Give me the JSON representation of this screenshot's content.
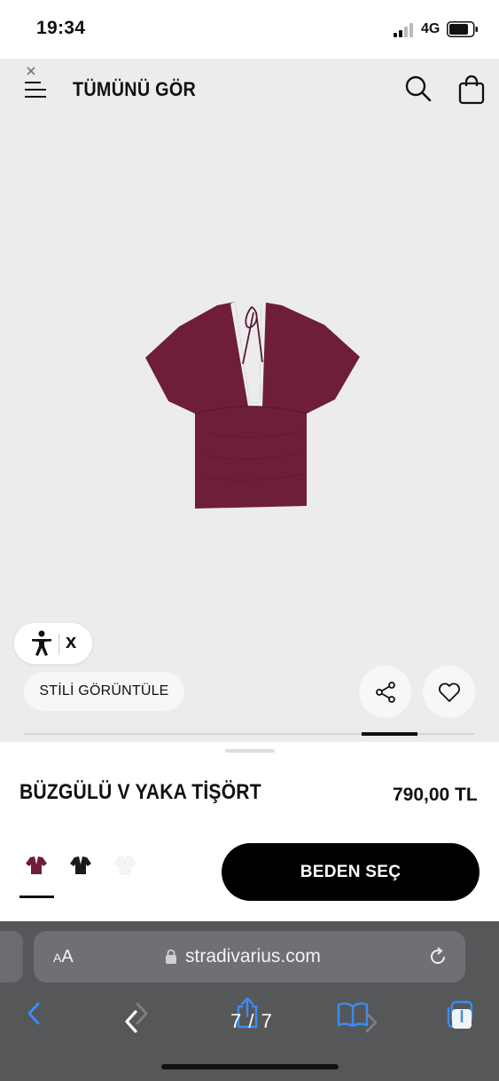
{
  "status_bar": {
    "time": "19:34",
    "network": "4G"
  },
  "header": {
    "title": "TÜMÜNÜ GÖR"
  },
  "icons": {
    "menu": "menu-icon",
    "search": "search-icon",
    "bag": "shopping-bag-icon",
    "accessibility": "accessibility-icon",
    "share": "share-icon",
    "favorite": "heart-icon",
    "lock": "lock-icon",
    "reload": "reload-icon"
  },
  "accessibility_widget": {
    "close_label": "x"
  },
  "actions": {
    "style_button": "STİLİ GÖRÜNTÜLE"
  },
  "gallery": {
    "progress": 0.875
  },
  "product": {
    "name": "BÜZGÜLÜ V YAKA TİŞÖRT",
    "price": "790,00 TL",
    "colors": [
      "#6e1e3a",
      "#1a1a1a",
      "#f4f4f4"
    ],
    "selected_color_index": 0,
    "size_button": "BEDEN SEÇ"
  },
  "browser": {
    "text_size_big": "A",
    "text_size_small": "A",
    "url": "stradivarius.com",
    "image_counter": "7 / 7"
  }
}
